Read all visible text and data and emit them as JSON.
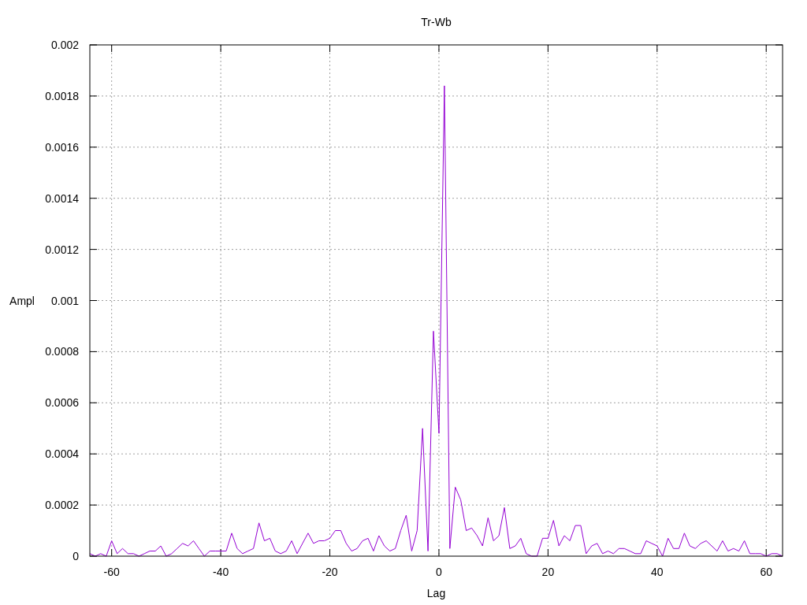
{
  "chart_data": {
    "type": "line",
    "title": "Tr-Wb",
    "xlabel": "Lag",
    "ylabel": "Ampl",
    "xlim": [
      -64,
      63
    ],
    "ylim": [
      0,
      0.002
    ],
    "grid": true,
    "xticks": [
      -60,
      -40,
      -20,
      0,
      20,
      40,
      60
    ],
    "yticks": [
      {
        "value": 0,
        "label": "0"
      },
      {
        "value": 0.0002,
        "label": "0.0002"
      },
      {
        "value": 0.0004,
        "label": "0.0004"
      },
      {
        "value": 0.0006,
        "label": "0.0006"
      },
      {
        "value": 0.0008,
        "label": "0.0008"
      },
      {
        "value": 0.001,
        "label": "0.001"
      },
      {
        "value": 0.0012,
        "label": "0.0012"
      },
      {
        "value": 0.0014,
        "label": "0.0014"
      },
      {
        "value": 0.0016,
        "label": "0.0016"
      },
      {
        "value": 0.0018,
        "label": "0.0018"
      },
      {
        "value": 0.002,
        "label": "0.002"
      }
    ],
    "x": [
      -64,
      -63,
      -62,
      -61,
      -60,
      -59,
      -58,
      -57,
      -56,
      -55,
      -54,
      -53,
      -52,
      -51,
      -50,
      -49,
      -48,
      -47,
      -46,
      -45,
      -44,
      -43,
      -42,
      -41,
      -40,
      -39,
      -38,
      -37,
      -36,
      -35,
      -34,
      -33,
      -32,
      -31,
      -30,
      -29,
      -28,
      -27,
      -26,
      -25,
      -24,
      -23,
      -22,
      -21,
      -20,
      -19,
      -18,
      -17,
      -16,
      -15,
      -14,
      -13,
      -12,
      -11,
      -10,
      -9,
      -8,
      -7,
      -6,
      -5,
      -4,
      -3,
      -2,
      -1,
      0,
      1,
      2,
      3,
      4,
      5,
      6,
      7,
      8,
      9,
      10,
      11,
      12,
      13,
      14,
      15,
      16,
      17,
      18,
      19,
      20,
      21,
      22,
      23,
      24,
      25,
      26,
      27,
      28,
      29,
      30,
      31,
      32,
      33,
      34,
      35,
      36,
      37,
      38,
      39,
      40,
      41,
      42,
      43,
      44,
      45,
      46,
      47,
      48,
      49,
      50,
      51,
      52,
      53,
      54,
      55,
      56,
      57,
      58,
      59,
      60,
      61,
      62,
      63
    ],
    "series": [
      {
        "color": "#9400d3",
        "values": [
          1e-05,
          0,
          1e-05,
          0,
          6e-05,
          1e-05,
          3e-05,
          1e-05,
          1e-05,
          0,
          1e-05,
          2e-05,
          2e-05,
          4e-05,
          0,
          1e-05,
          3e-05,
          5e-05,
          4e-05,
          6e-05,
          3e-05,
          0,
          2e-05,
          2e-05,
          2e-05,
          2e-05,
          9e-05,
          3e-05,
          1e-05,
          2e-05,
          3e-05,
          0.00013,
          6e-05,
          7e-05,
          2e-05,
          1e-05,
          2e-05,
          6e-05,
          1e-05,
          5e-05,
          9e-05,
          5e-05,
          6e-05,
          6e-05,
          7e-05,
          0.0001,
          0.0001,
          5e-05,
          2e-05,
          3e-05,
          6e-05,
          7e-05,
          2e-05,
          8e-05,
          4e-05,
          2e-05,
          3e-05,
          0.0001,
          0.00016,
          2e-05,
          0.0001,
          0.0005,
          2e-05,
          0.00088,
          0.00048,
          0.00184,
          3e-05,
          0.00027,
          0.00022,
          0.0001,
          0.00011,
          8e-05,
          4e-05,
          0.00015,
          6e-05,
          8e-05,
          0.00019,
          3e-05,
          4e-05,
          7e-05,
          1e-05,
          0,
          0,
          7e-05,
          7e-05,
          0.00014,
          4e-05,
          8e-05,
          6e-05,
          0.00012,
          0.00012,
          1e-05,
          4e-05,
          5e-05,
          1e-05,
          2e-05,
          1e-05,
          3e-05,
          3e-05,
          2e-05,
          1e-05,
          1e-05,
          6e-05,
          5e-05,
          4e-05,
          0,
          7e-05,
          3e-05,
          3e-05,
          9e-05,
          4e-05,
          3e-05,
          5e-05,
          6e-05,
          4e-05,
          2e-05,
          6e-05,
          2e-05,
          3e-05,
          2e-05,
          6e-05,
          1e-05,
          1e-05,
          1e-05,
          0,
          1e-05,
          1e-05,
          0
        ]
      }
    ]
  }
}
